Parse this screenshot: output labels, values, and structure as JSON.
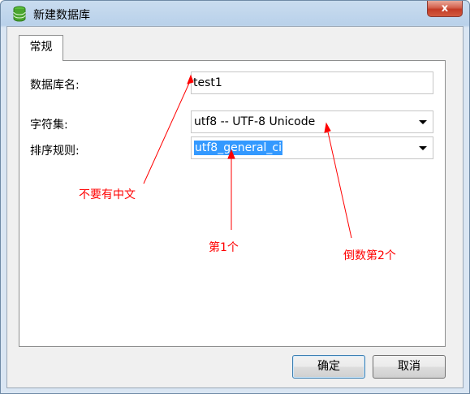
{
  "window": {
    "title": "新建数据库",
    "close_label": "x"
  },
  "tabs": [
    {
      "label": "常规"
    }
  ],
  "form": {
    "db_name_label": "数据库名:",
    "db_name_value": "test1",
    "charset_label": "字符集:",
    "charset_value": "utf8 -- UTF-8 Unicode",
    "collation_label": "排序规则:",
    "collation_value": "utf8_general_ci"
  },
  "annotations": {
    "no_chinese": "不要有中文",
    "first_one": "第1个",
    "second_last": "倒数第2个"
  },
  "buttons": {
    "ok": "确定",
    "cancel": "取消"
  },
  "colors": {
    "annotation": "#ff0000",
    "selection": "#3399ff"
  }
}
